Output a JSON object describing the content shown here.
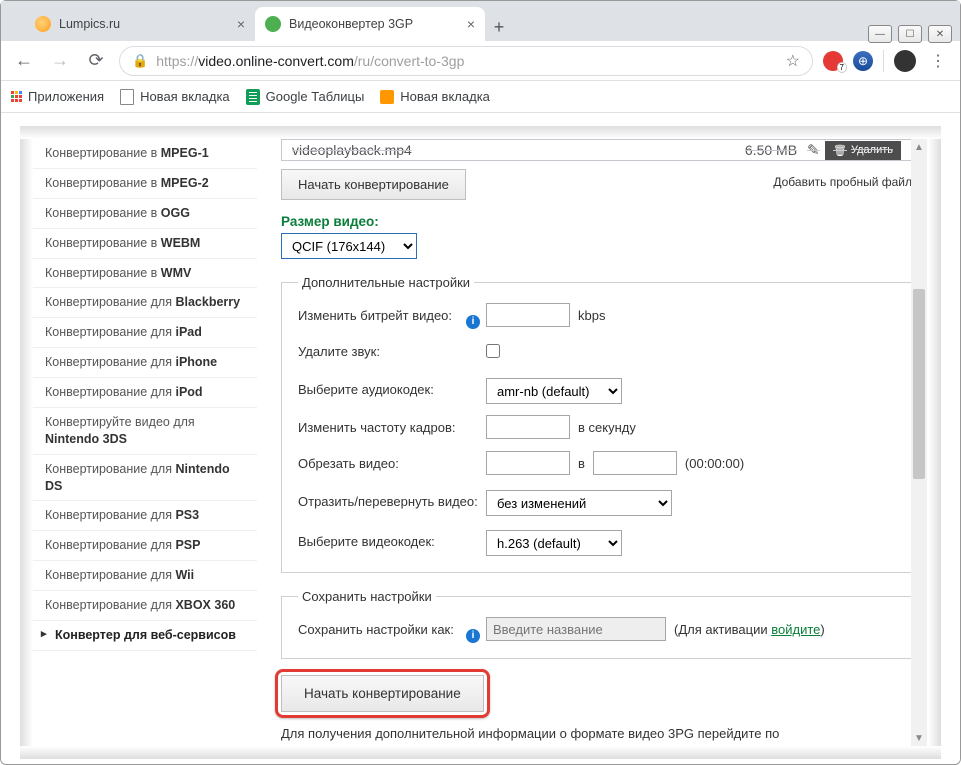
{
  "window": {
    "tabs": [
      {
        "title": "Lumpics.ru"
      },
      {
        "title": "Видеоконвертер 3GP"
      }
    ]
  },
  "addressbar": {
    "proto": "https://",
    "host": "video.online-convert.com",
    "path": "/ru/convert-to-3gp"
  },
  "bookmarks": {
    "apps": "Приложения",
    "items": [
      "Новая вкладка",
      "Google Таблицы",
      "Новая вкладка"
    ]
  },
  "sidebar": {
    "prefix": "Конвертирование в ",
    "prefix_for": "Конвертирование для ",
    "items": [
      {
        "t": "in",
        "fmt": "MPEG-1"
      },
      {
        "t": "in",
        "fmt": "MPEG-2"
      },
      {
        "t": "in",
        "fmt": "OGG"
      },
      {
        "t": "in",
        "fmt": "WEBM"
      },
      {
        "t": "in",
        "fmt": "WMV"
      },
      {
        "t": "for",
        "fmt": "Blackberry"
      },
      {
        "t": "for",
        "fmt": "iPad"
      },
      {
        "t": "for",
        "fmt": "iPhone"
      },
      {
        "t": "for",
        "fmt": "iPod"
      },
      {
        "t": "custom",
        "pre": "Конвертируйте видео для ",
        "fmt": "Nintendo 3DS"
      },
      {
        "t": "for",
        "fmt": "Nintendo DS"
      },
      {
        "t": "for",
        "fmt": "PS3"
      },
      {
        "t": "for",
        "fmt": "PSP"
      },
      {
        "t": "for",
        "fmt": "Wii"
      },
      {
        "t": "for",
        "fmt": "XBOX 360"
      }
    ],
    "category": "Конвертер для веб-сервисов"
  },
  "file": {
    "name": "videoplayback.mp4",
    "size": "6.50 MB",
    "delete": "Удалить"
  },
  "buttons": {
    "start": "Начать конвертирование",
    "add_trial": "Добавить пробный файл"
  },
  "video_size": {
    "label": "Размер видео:",
    "value": "QCIF (176x144)"
  },
  "advanced": {
    "legend": "Дополнительные настройки",
    "bitrate_lbl": "Изменить битрейт видео:",
    "bitrate_unit": "kbps",
    "remove_audio_lbl": "Удалите звук:",
    "audio_codec_lbl": "Выберите аудиокодек:",
    "audio_codec_value": "amr-nb (default)",
    "fps_lbl": "Изменить частоту кадров:",
    "fps_unit": "в секунду",
    "trim_lbl": "Обрезать видео:",
    "trim_sep": "в",
    "trim_hint": "(00:00:00)",
    "flip_lbl": "Отразить/перевернуть видео:",
    "flip_value": "без изменений",
    "video_codec_lbl": "Выберите видеокодек:",
    "video_codec_value": "h.263 (default)"
  },
  "save": {
    "legend": "Сохранить настройки",
    "lbl": "Сохранить настройки как:",
    "placeholder": "Введите название",
    "hint_pre": "(Для активации ",
    "hint_link": "войдите",
    "hint_post": ")"
  },
  "footnote": "Для получения дополнительной информации о формате видео 3PG перейдите по"
}
